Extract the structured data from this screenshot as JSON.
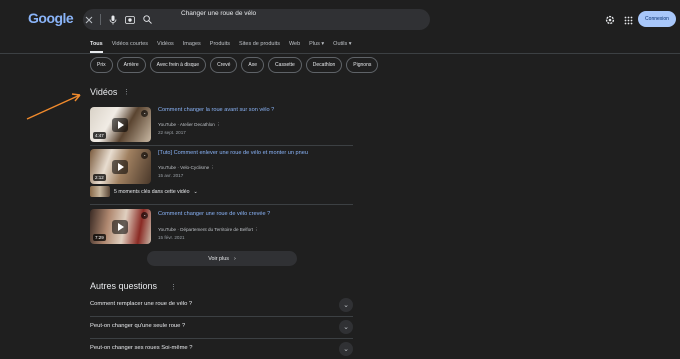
{
  "logo": {
    "text": "Google"
  },
  "search": {
    "query": "Changer une roue de vélo"
  },
  "header": {
    "signin_label": "Connexion"
  },
  "tabs": [
    {
      "label": "Tous"
    },
    {
      "label": "Vidéos courtes"
    },
    {
      "label": "Vidéos"
    },
    {
      "label": "Images"
    },
    {
      "label": "Produits"
    },
    {
      "label": "Sites de produits"
    },
    {
      "label": "Web"
    },
    {
      "label": "Plus"
    },
    {
      "label": "Outils"
    }
  ],
  "chips": [
    "Prix",
    "Arrière",
    "Avec frein à disque",
    "Crevé",
    "Axe",
    "Cassette",
    "Decathlon",
    "Pignons"
  ],
  "videos": {
    "section_title": "Vidéos",
    "items": [
      {
        "title": "Comment changer la roue avant sur son vélo ?",
        "source": "YouTube · Atelier Decathlon",
        "date": "22 sept. 2017",
        "duration": "4:47"
      },
      {
        "title": "[Tuto] Comment enlever une roue de vélo et monter un pneu",
        "source": "YouTube · Velo-Cyclisme",
        "date": "15 avr. 2017",
        "duration": "2:12"
      },
      {
        "title": "Comment changer une roue de vélo crevée ?",
        "source": "YouTube · Département du Territoire de Belfort",
        "date": "15 févr. 2021",
        "duration": "7:29"
      }
    ],
    "moments_label": "5 moments clés dans cette vidéo",
    "see_more_label": "Voir plus"
  },
  "people_also_ask": {
    "title": "Autres questions",
    "questions": [
      "Comment remplacer une roue de vélo ?",
      "Peut-on changer qu'une seule roue ?",
      "Peut-on changer ses roues Soi-même ?"
    ]
  },
  "colors": {
    "background": "#1f1f1f",
    "link": "#8ab4f8",
    "accent": "#a8c7fa",
    "annotation_arrow": "#f08a2c"
  }
}
